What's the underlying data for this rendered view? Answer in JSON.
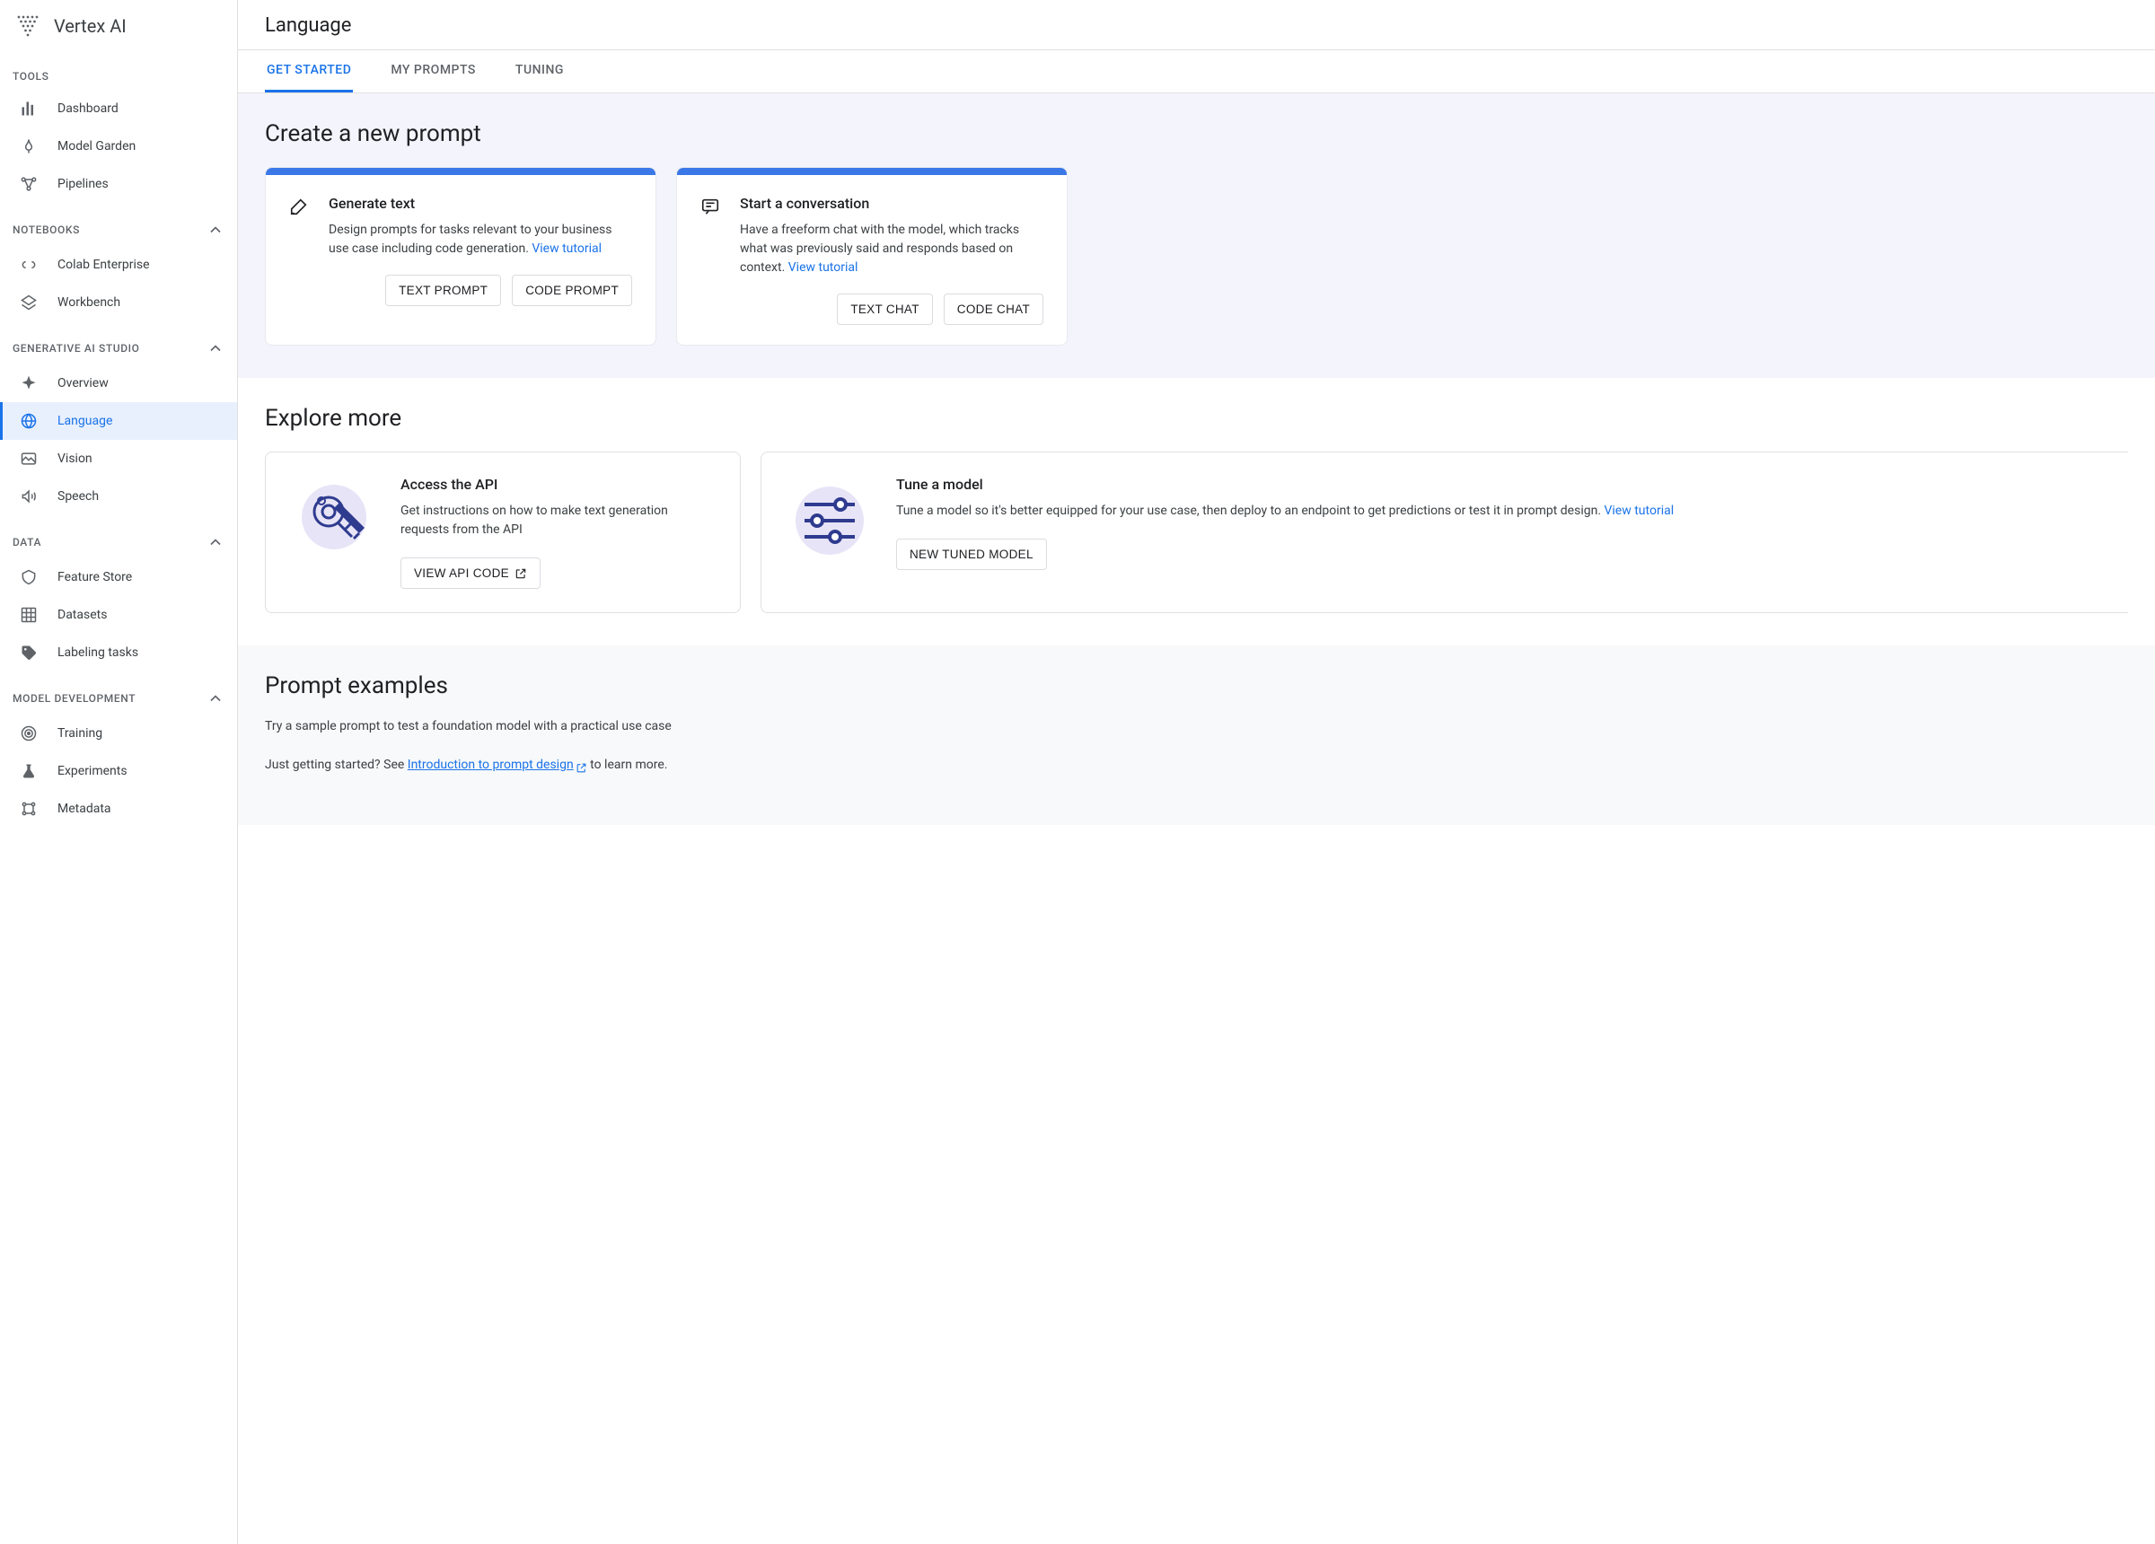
{
  "brand": "Vertex AI",
  "sidebar": {
    "sections": [
      {
        "label": "TOOLS",
        "collapsible": false,
        "items": [
          {
            "icon": "dashboard",
            "label": "Dashboard"
          },
          {
            "icon": "model-garden",
            "label": "Model Garden"
          },
          {
            "icon": "pipelines",
            "label": "Pipelines"
          }
        ]
      },
      {
        "label": "NOTEBOOKS",
        "collapsible": true,
        "items": [
          {
            "icon": "colab",
            "label": "Colab Enterprise"
          },
          {
            "icon": "workbench",
            "label": "Workbench"
          }
        ]
      },
      {
        "label": "GENERATIVE AI STUDIO",
        "collapsible": true,
        "items": [
          {
            "icon": "overview",
            "label": "Overview"
          },
          {
            "icon": "language",
            "label": "Language",
            "active": true
          },
          {
            "icon": "vision",
            "label": "Vision"
          },
          {
            "icon": "speech",
            "label": "Speech"
          }
        ]
      },
      {
        "label": "DATA",
        "collapsible": true,
        "items": [
          {
            "icon": "feature-store",
            "label": "Feature Store"
          },
          {
            "icon": "datasets",
            "label": "Datasets"
          },
          {
            "icon": "labeling",
            "label": "Labeling tasks"
          }
        ]
      },
      {
        "label": "MODEL DEVELOPMENT",
        "collapsible": true,
        "items": [
          {
            "icon": "training",
            "label": "Training"
          },
          {
            "icon": "experiments",
            "label": "Experiments"
          },
          {
            "icon": "metadata",
            "label": "Metadata"
          }
        ]
      }
    ]
  },
  "page": {
    "title": "Language",
    "tabs": [
      {
        "label": "GET STARTED",
        "active": true
      },
      {
        "label": "MY PROMPTS"
      },
      {
        "label": "TUNING"
      }
    ]
  },
  "create": {
    "heading": "Create a new prompt",
    "cards": [
      {
        "icon": "pencil",
        "title": "Generate text",
        "desc": "Design prompts for tasks relevant to your business use case including code generation. ",
        "tutorial": "View tutorial",
        "buttons": [
          "TEXT PROMPT",
          "CODE PROMPT"
        ]
      },
      {
        "icon": "chat",
        "title": "Start a conversation",
        "desc": "Have a freeform chat with the model, which tracks what was previously said and responds based on context. ",
        "tutorial": "View tutorial",
        "buttons": [
          "TEXT CHAT",
          "CODE CHAT"
        ]
      }
    ]
  },
  "explore": {
    "heading": "Explore more",
    "cards": [
      {
        "illus": "keys",
        "title": "Access the API",
        "desc": "Get instructions on how to make text generation requests from the API",
        "tutorial": "",
        "button": "VIEW API CODE",
        "button_ext": true
      },
      {
        "illus": "sliders",
        "title": "Tune a model",
        "desc": "Tune a model so it's better equipped for your use case, then deploy to an endpoint to get predictions or test it in prompt design. ",
        "tutorial": "View tutorial",
        "button": "NEW TUNED MODEL",
        "button_ext": false
      }
    ]
  },
  "examples": {
    "heading": "Prompt examples",
    "intro": "Try a sample prompt to test a foundation model with a practical use case",
    "starter_prefix": "Just getting started? See ",
    "starter_link": "Introduction to prompt design",
    "starter_suffix": " to learn more."
  }
}
